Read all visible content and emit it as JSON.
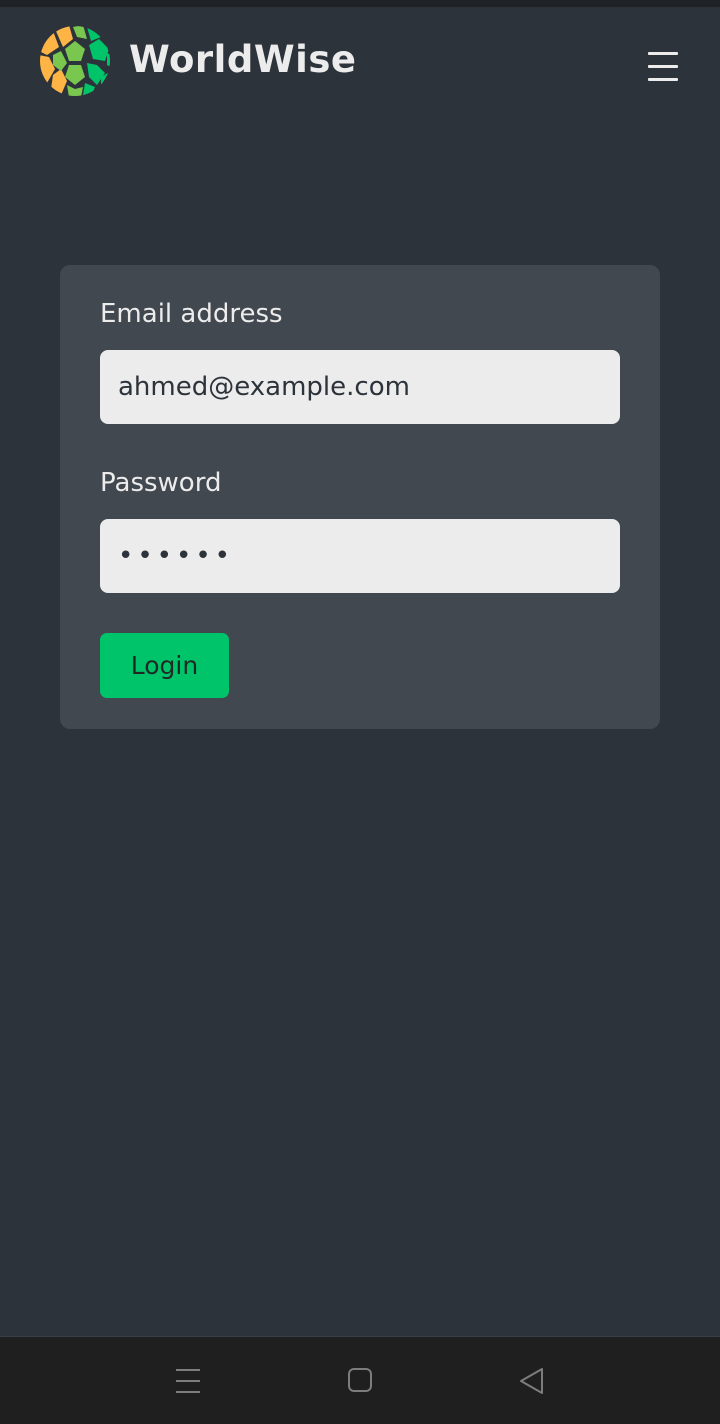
{
  "header": {
    "brand": "WorldWise",
    "logo_icon": "globe-logo-icon",
    "menu_icon": "hamburger-menu-icon"
  },
  "login_form": {
    "email_label": "Email address",
    "email_value": "ahmed@example.com",
    "password_label": "Password",
    "password_value": "qwerty",
    "login_label": "Login"
  },
  "system_nav": {
    "icons": [
      "recent-apps-icon",
      "home-icon",
      "back-icon"
    ]
  },
  "colors": {
    "background": "#2d333b",
    "card": "#42484f",
    "accent": "#00c46a",
    "logo_orange": "#ffb545",
    "logo_green": "#00c46a",
    "logo_lightgreen": "#7ac74f"
  }
}
